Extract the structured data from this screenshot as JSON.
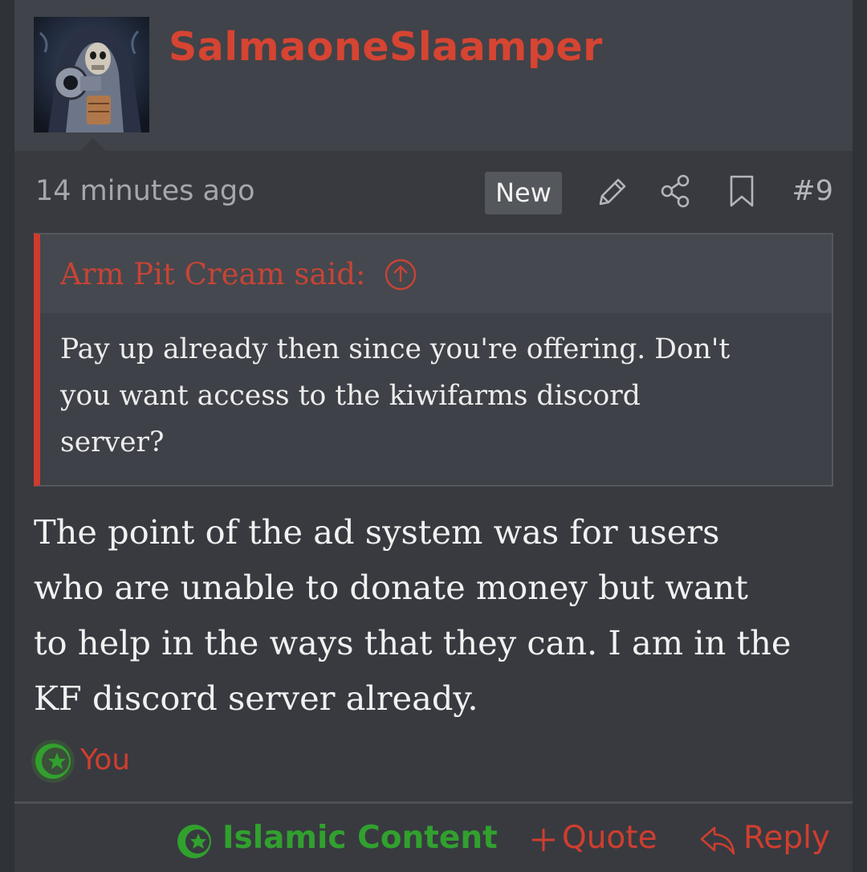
{
  "post": {
    "username": "SalmaoneSlaamper",
    "timestamp": "14 minutes ago",
    "badge": "New",
    "post_number": "#9",
    "quote": {
      "author_label": "Arm Pit Cream said:",
      "text": "Pay up already then since you're offering. Don't\nyou want access to the kiwifarms discord\nserver?"
    },
    "message": "The point of the ad system was for users\nwho are unable to donate money but want\nto help in the ways that they can. I am in the\nKF discord server already.",
    "reaction": {
      "label": "You",
      "icon": "islamic-content-reaction-icon"
    },
    "footer": {
      "reaction_label": "Islamic Content",
      "quote_label": "Quote",
      "reply_label": "Reply"
    },
    "colors": {
      "username": "#d64432",
      "accent": "#cf3e2e",
      "reaction_green": "#31a02e",
      "background": "#383a40"
    }
  }
}
